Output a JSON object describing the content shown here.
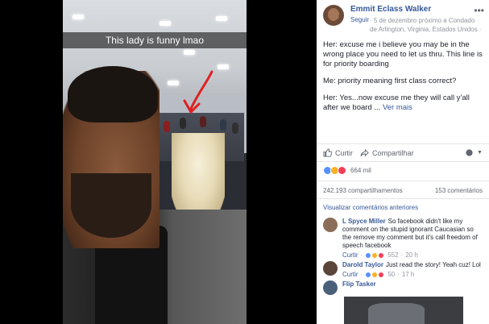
{
  "photo": {
    "caption": "This lady is funny lmao"
  },
  "post": {
    "author": "Emmit Eclass Walker",
    "follow_label": "Seguir",
    "meta": "· 5 de dezembro próximo a Condado de Arlington, Virginia, Estados Unidos ·",
    "paragraphs": [
      "Her: excuse me i believe you may be in the wrong place you need to let us thru. This line is for priority boarding",
      "Me: priority meaning first class correct?",
      "Her: Yes...now excuse me they will call y'all after we board ..."
    ],
    "see_more": "Ver mais",
    "more_icon": "more-icon"
  },
  "actions": {
    "like": "Curtir",
    "share": "Compartilhar"
  },
  "stats": {
    "reactions_count": "664 mil",
    "shares": "242.193 compartilhamentos",
    "comments": "153 comentários",
    "reaction_colors": [
      "#5890ff",
      "#f7b125",
      "#f33e58"
    ]
  },
  "previous_comments_label": "Visualizar comentários anteriores",
  "comments": [
    {
      "name": "L Spyce Miller",
      "text": "So facebook didn't like my comment on the stupid ignorant Caucasian so the remove my comment but it's call freedom of speech facebook",
      "like_label": "Curtir",
      "reaction_count": "552",
      "time": "20 h",
      "avatar_color": "#8a6e5a"
    },
    {
      "name": "Darold Taylor",
      "text": "Just read the story! Yeah cuz! Lol",
      "like_label": "Curtir",
      "reaction_count": "50",
      "time": "17 h",
      "avatar_color": "#5b4438"
    },
    {
      "name": "Flip Tasker",
      "text": "",
      "avatar_color": "#4a5f7a"
    }
  ]
}
